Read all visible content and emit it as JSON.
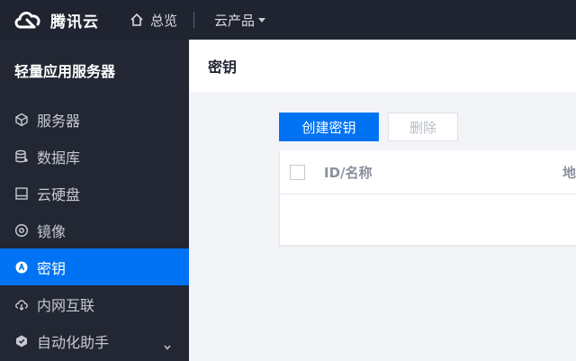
{
  "topbar": {
    "brand": "腾讯云",
    "home_label": "总览",
    "products_label": "云产品"
  },
  "sidebar": {
    "title": "轻量应用服务器",
    "items": [
      {
        "label": "服务器",
        "icon": "cube-icon",
        "active": false
      },
      {
        "label": "数据库",
        "icon": "database-icon",
        "active": false
      },
      {
        "label": "云硬盘",
        "icon": "disk-icon",
        "active": false
      },
      {
        "label": "镜像",
        "icon": "disc-icon",
        "active": false
      },
      {
        "label": "密钥",
        "icon": "key-icon",
        "active": true
      },
      {
        "label": "内网互联",
        "icon": "network-icon",
        "active": false
      },
      {
        "label": "自动化助手",
        "icon": "assistant-icon",
        "active": false
      }
    ]
  },
  "main": {
    "title": "密钥",
    "create_button": "创建密钥",
    "delete_button": "删除",
    "table": {
      "columns": [
        "ID/名称",
        "地"
      ]
    }
  },
  "colors": {
    "topbar_bg": "#1f2430",
    "sidebar_bg": "#232733",
    "accent": "#0073f4"
  }
}
